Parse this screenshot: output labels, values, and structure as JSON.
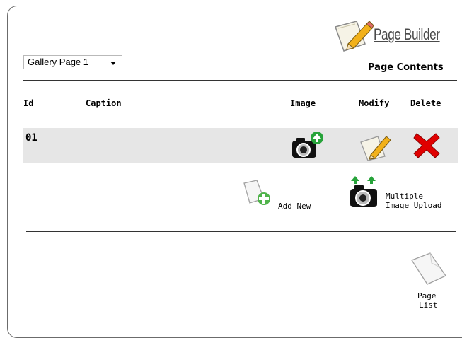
{
  "header": {
    "brand_title": "Page Builder",
    "section_title": "Page Contents"
  },
  "page_select": {
    "selected": "Gallery Page 1"
  },
  "table": {
    "columns": {
      "id": "Id",
      "caption": "Caption",
      "image": "Image",
      "modify": "Modify",
      "delete": "Delete"
    },
    "rows": [
      {
        "id": "01",
        "caption": ""
      }
    ]
  },
  "actions": {
    "add_new": "Add New",
    "multiple_upload_line1": "Multiple",
    "multiple_upload_line2": "Image Upload",
    "page_list_line1": "Page",
    "page_list_line2": "List"
  },
  "colors": {
    "accent_green": "#27a33a",
    "delete_red": "#e00000",
    "row_bg": "#e6e6e6",
    "pencil": "#f2b11a"
  },
  "icons": [
    "notepad-pencil-icon",
    "camera-upload-icon",
    "edit-pencil-icon",
    "delete-x-icon",
    "add-page-icon",
    "multi-camera-upload-icon",
    "page-icon"
  ]
}
